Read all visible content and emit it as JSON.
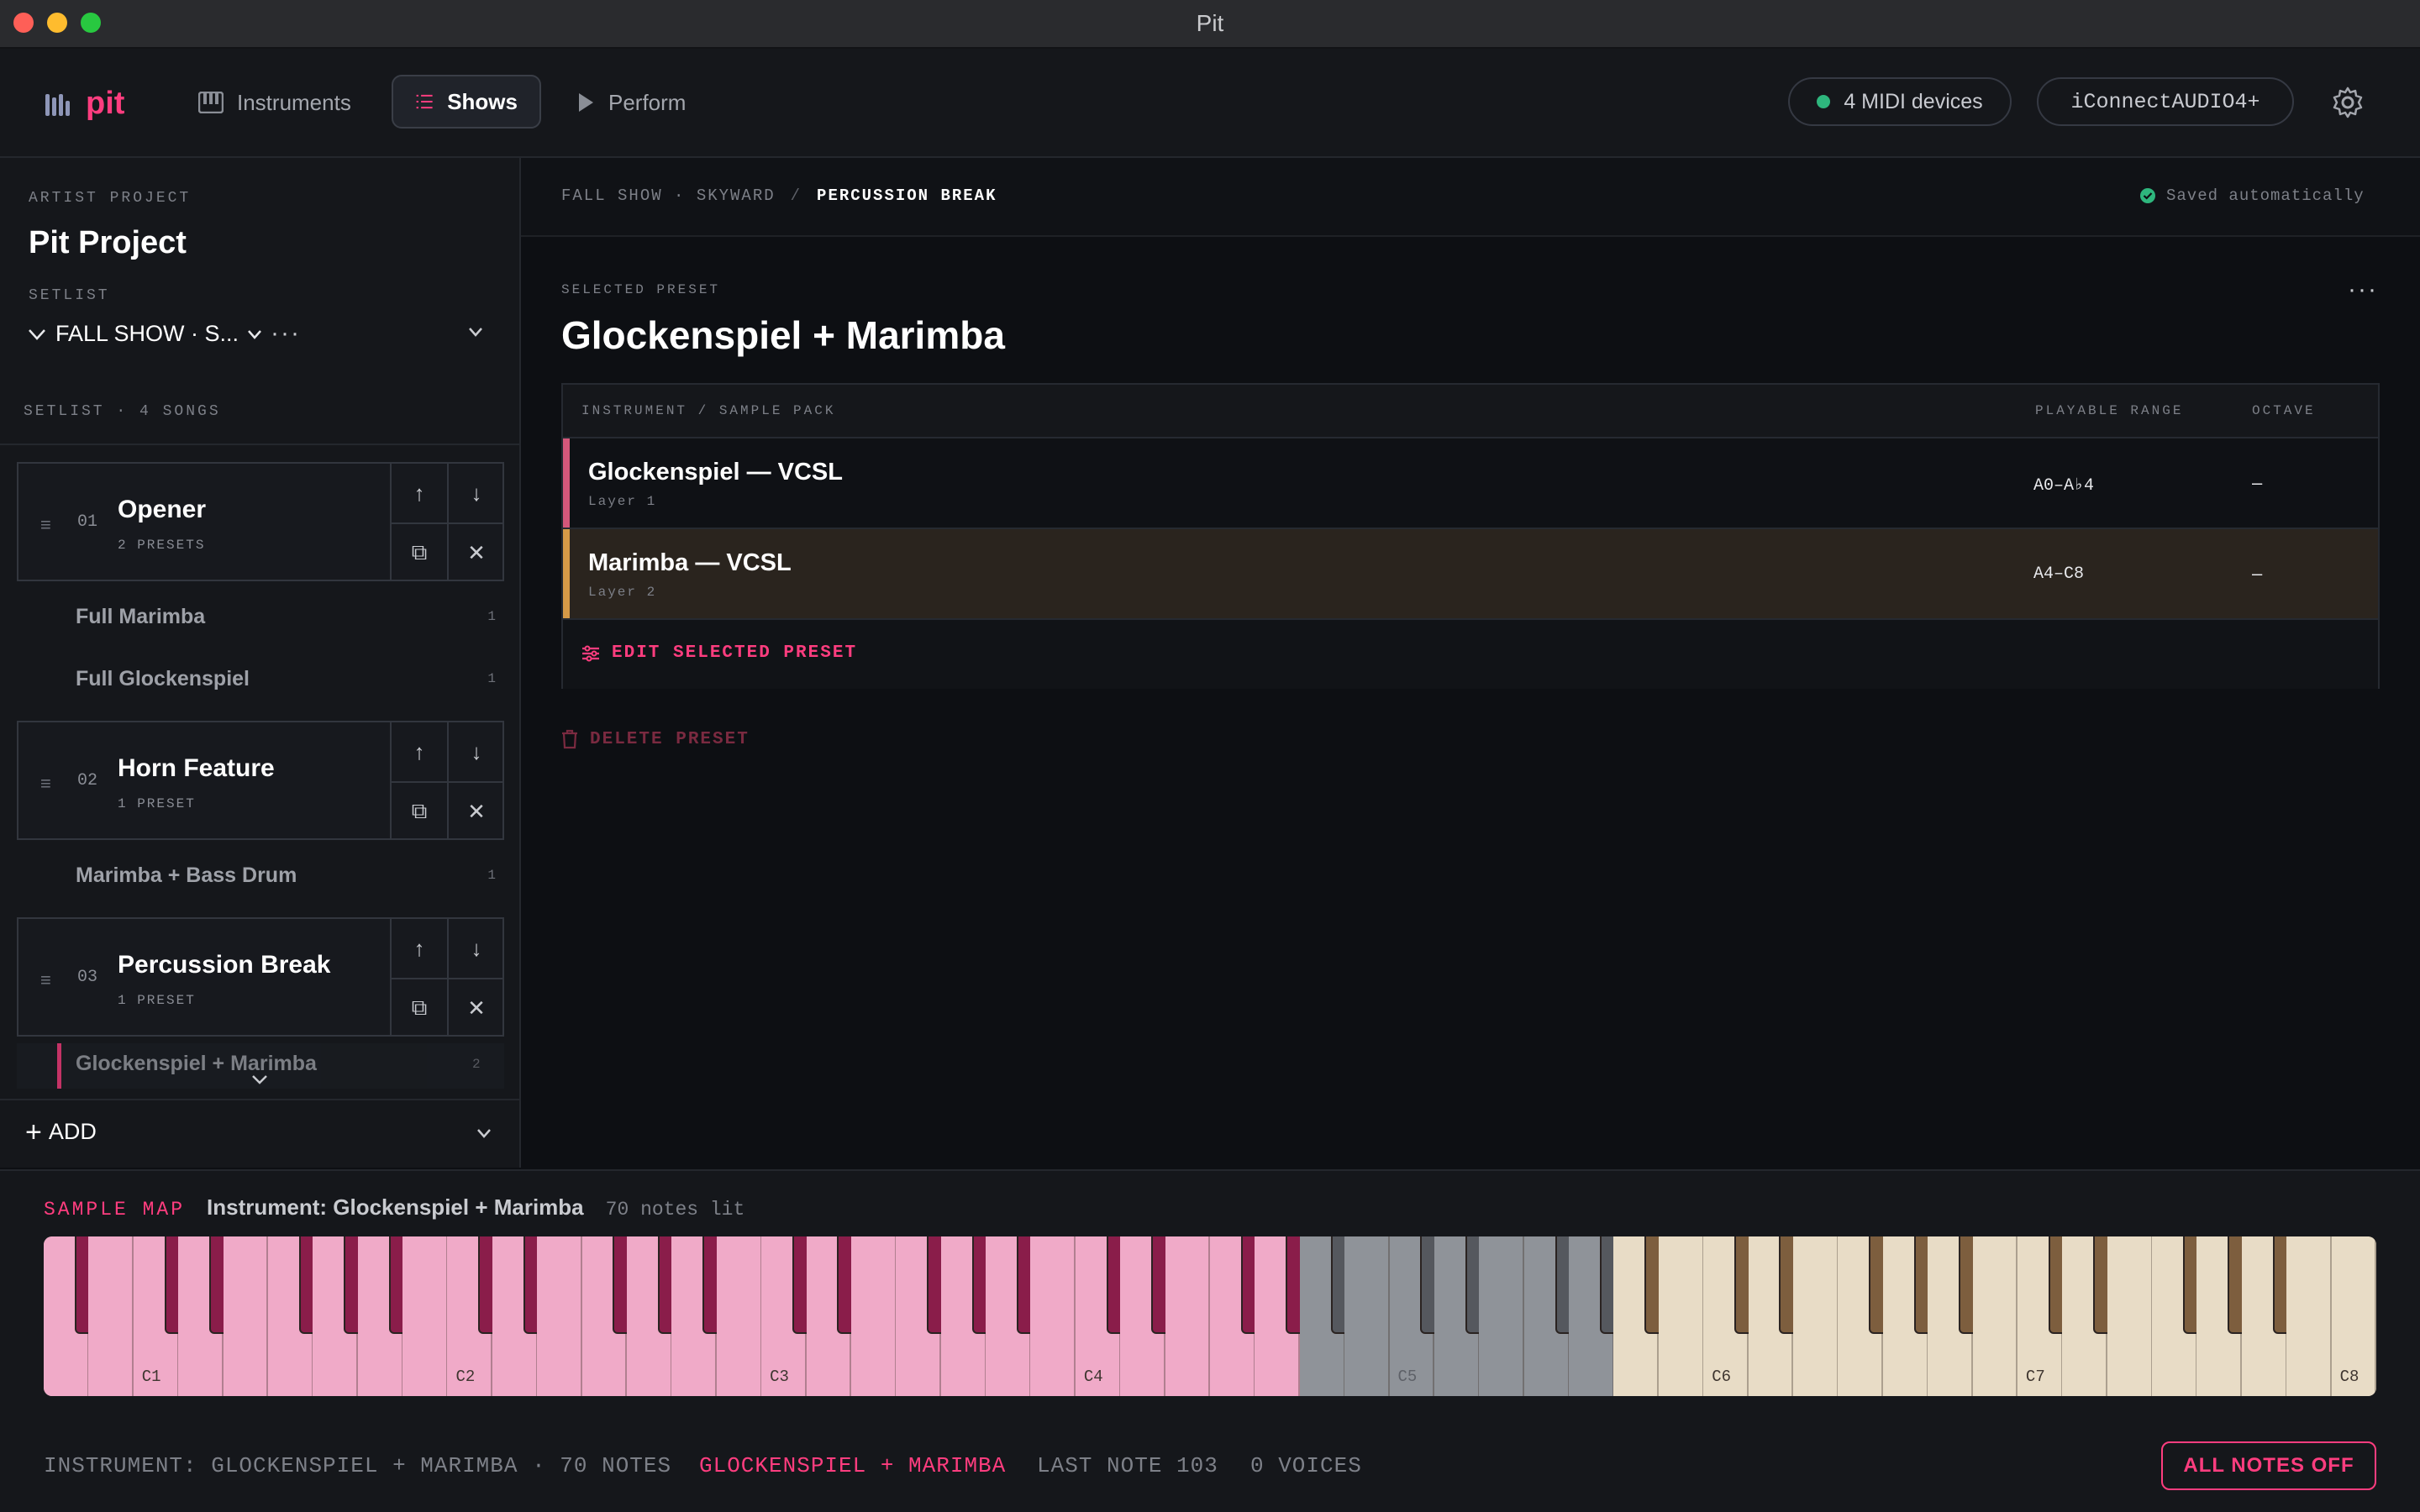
{
  "window": {
    "title": "Pit"
  },
  "app": {
    "logo_text": "pit"
  },
  "nav": {
    "items": [
      {
        "label": "Instruments",
        "icon": "piano-icon"
      },
      {
        "label": "Shows",
        "icon": "list-icon"
      },
      {
        "label": "Perform",
        "icon": "play-icon"
      }
    ],
    "active": "Shows",
    "midi_devices": "4 MIDI devices",
    "audio_device": "iConnectAUDIO4+"
  },
  "sidebar": {
    "project_label": "ARTIST PROJECT",
    "project_name": "Pit Project",
    "setlist_label": "SETLIST",
    "setlist_name": "FALL SHOW · S...",
    "setlist_summary": "SETLIST · 4 SONGS",
    "songs": [
      {
        "number": "01",
        "name": "Opener",
        "count": "2 PRESETS",
        "presets": [
          {
            "name": "Full Marimba",
            "n": "1"
          },
          {
            "name": "Full Glockenspiel",
            "n": "1"
          }
        ]
      },
      {
        "number": "02",
        "name": "Horn Feature",
        "count": "1 PRESET",
        "presets": [
          {
            "name": "Marimba + Bass Drum",
            "n": "1"
          }
        ]
      },
      {
        "number": "03",
        "name": "Percussion Break",
        "count": "1 PRESET",
        "presets": [
          {
            "name": "Glockenspiel + Marimba",
            "n": "2"
          }
        ]
      }
    ],
    "add_label": "ADD"
  },
  "main": {
    "breadcrumb": {
      "show": "FALL SHOW · SKYWARD",
      "separator": "/",
      "current": "PERCUSSION BREAK"
    },
    "saved_status": "Saved automatically",
    "selected_label": "SELECTED PRESET",
    "preset_title": "Glockenspiel + Marimba",
    "table": {
      "headers": {
        "instrument": "INSTRUMENT / SAMPLE PACK",
        "range": "PLAYABLE RANGE",
        "octave": "OCTAVE"
      },
      "rows": [
        {
          "name": "Glockenspiel — VCSL",
          "layer": "Layer 1",
          "range": "A0–A♭4",
          "octave": "–",
          "color": "#d4577a"
        },
        {
          "name": "Marimba — VCSL",
          "layer": "Layer 2",
          "range": "A4–C8",
          "octave": "–",
          "color": "#d69a47"
        }
      ]
    },
    "edit_label": "EDIT SELECTED PRESET",
    "delete_label": "DELETE PRESET"
  },
  "sample_map": {
    "label": "SAMPLE MAP",
    "instrument": "Instrument: Glockenspiel + Marimba",
    "lit": "70 notes lit",
    "octave_labels": [
      "C1",
      "C2",
      "C3",
      "C4",
      "C5",
      "C6",
      "C7",
      "C8"
    ],
    "colors": {
      "glock_white": "#f0aac8",
      "glock_black": "#8a1d4a",
      "gap_white": "#8f9399",
      "gap_black": "#55585e",
      "marimba_white": "#e8dcc6",
      "marimba_black": "#7d5e3e"
    }
  },
  "status": {
    "instrument": "INSTRUMENT: GLOCKENSPIEL + MARIMBA · 70 NOTES",
    "preset": "GLOCKENSPIEL + MARIMBA",
    "last_note": "LAST NOTE 103",
    "voices": "0 VOICES",
    "all_notes_off": "ALL NOTES OFF"
  },
  "colors": {
    "accent": "#ff3d7f",
    "saved_green": "#2eb67d"
  }
}
